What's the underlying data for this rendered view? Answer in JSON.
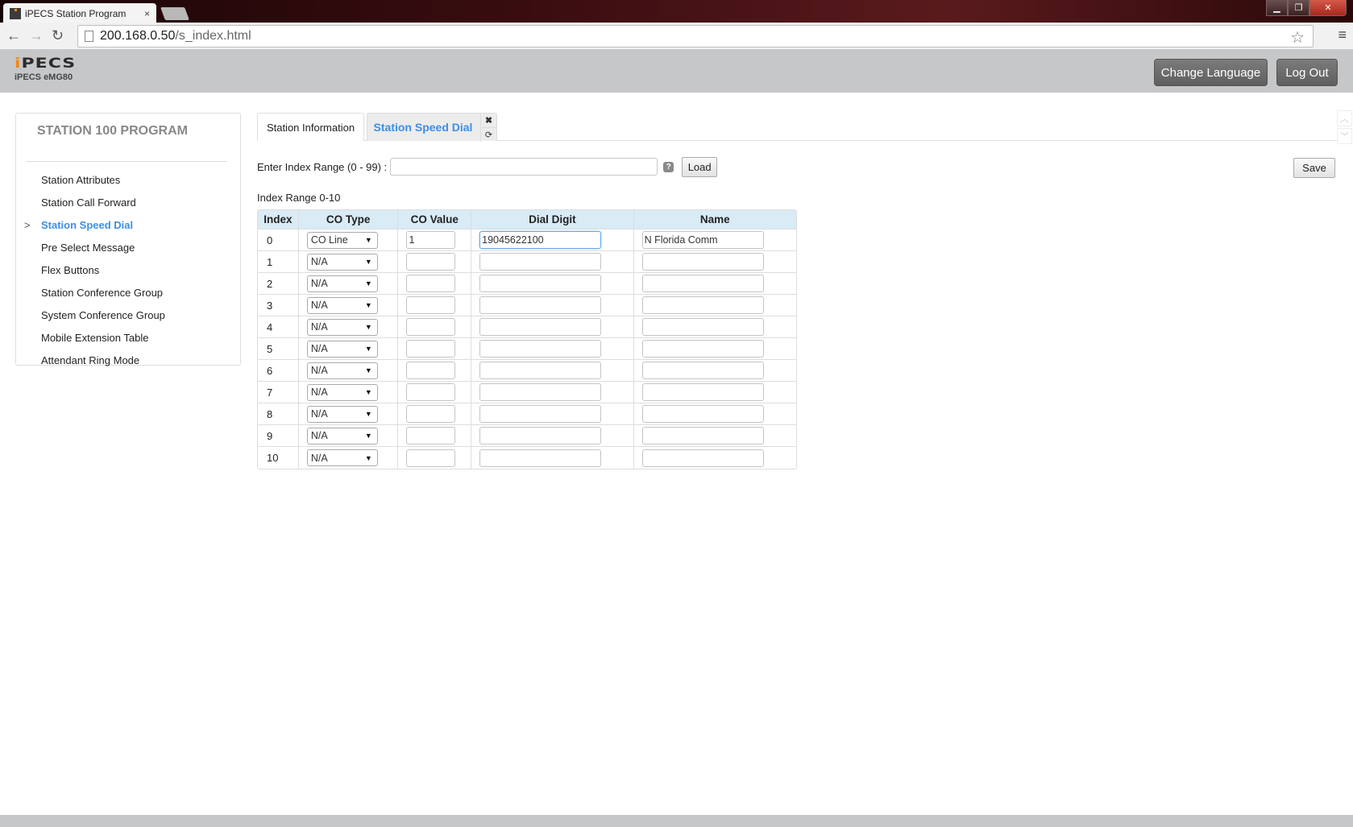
{
  "browser": {
    "tab_title": "iPECS Station Program",
    "tab_close": "×",
    "url_host": "200.168.0.50",
    "url_path": "/s_index.html",
    "back": "←",
    "forward": "→",
    "reload": "↻",
    "star": "☆",
    "menu": "≡",
    "win_min": "▁",
    "win_max": "❐",
    "win_close": "✕"
  },
  "header": {
    "logo": "iPECS",
    "model": "iPECS eMG80",
    "change_language": "Change Language",
    "log_out": "Log Out"
  },
  "sidebar": {
    "title": "STATION 100 PROGRAM",
    "active_marker": ">",
    "items": [
      {
        "label": "Station Attributes"
      },
      {
        "label": "Station Call Forward"
      },
      {
        "label": "Station Speed Dial",
        "active": true
      },
      {
        "label": "Pre Select Message"
      },
      {
        "label": "Flex Buttons"
      },
      {
        "label": "Station Conference Group"
      },
      {
        "label": "System Conference Group"
      },
      {
        "label": "Mobile Extension Table"
      },
      {
        "label": "Attendant Ring Mode"
      }
    ]
  },
  "tabs": [
    {
      "label": "Station Information"
    },
    {
      "label": "Station Speed Dial",
      "active": true
    }
  ],
  "tab_actions": {
    "close": "✖",
    "refresh": "⟳"
  },
  "scroll": {
    "up": "︿",
    "down": "﹀"
  },
  "range": {
    "label": "Enter Index Range (0 - 99) :",
    "value": "",
    "help": "?",
    "load": "Load",
    "caption": "Index Range 0-10"
  },
  "save": "Save",
  "table": {
    "headers": [
      "Index",
      "CO Type",
      "CO Value",
      "Dial Digit",
      "Name"
    ],
    "rows": [
      {
        "index": "0",
        "co_type": "CO Line",
        "co_value": "1",
        "dial_digit": "19045622100",
        "name": "N Florida Comm"
      },
      {
        "index": "1",
        "co_type": "N/A",
        "co_value": "",
        "dial_digit": "",
        "name": ""
      },
      {
        "index": "2",
        "co_type": "N/A",
        "co_value": "",
        "dial_digit": "",
        "name": ""
      },
      {
        "index": "3",
        "co_type": "N/A",
        "co_value": "",
        "dial_digit": "",
        "name": ""
      },
      {
        "index": "4",
        "co_type": "N/A",
        "co_value": "",
        "dial_digit": "",
        "name": ""
      },
      {
        "index": "5",
        "co_type": "N/A",
        "co_value": "",
        "dial_digit": "",
        "name": ""
      },
      {
        "index": "6",
        "co_type": "N/A",
        "co_value": "",
        "dial_digit": "",
        "name": ""
      },
      {
        "index": "7",
        "co_type": "N/A",
        "co_value": "",
        "dial_digit": "",
        "name": ""
      },
      {
        "index": "8",
        "co_type": "N/A",
        "co_value": "",
        "dial_digit": "",
        "name": ""
      },
      {
        "index": "9",
        "co_type": "N/A",
        "co_value": "",
        "dial_digit": "",
        "name": ""
      },
      {
        "index": "10",
        "co_type": "N/A",
        "co_value": "",
        "dial_digit": "",
        "name": ""
      }
    ]
  },
  "colors": {
    "accent": "#3c8fe8",
    "header_bg": "#c6c7c9",
    "table_header_bg": "#d9ebf5",
    "logo_dot": "#f08a1c"
  }
}
